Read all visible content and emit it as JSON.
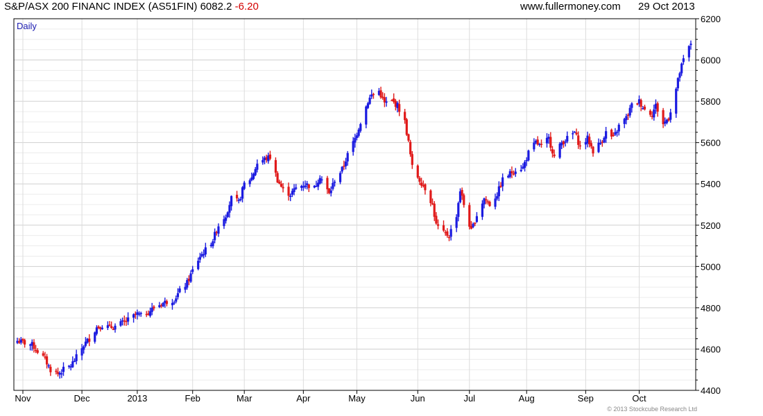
{
  "header": {
    "title": "S&P/ASX 200 FINANC INDEX (AS51FIN) 6082.2",
    "change": "-6.20",
    "site": "www.fullermoney.com",
    "date": "29 Oct 2013"
  },
  "footer": {
    "copyright": "© 2013 Stockcube Research Ltd"
  },
  "colors": {
    "up": "#1a1ae0",
    "down": "#e01a1a",
    "grid": "#d4d4d4",
    "frame": "#000000",
    "change": "#d40000",
    "period_label": "#1a1ab0"
  },
  "chart_data": {
    "type": "ohlc",
    "period_label": "Daily",
    "ylim": [
      4400,
      6200
    ],
    "y_ticks": [
      4400,
      4600,
      4800,
      5000,
      5200,
      5400,
      5600,
      5800,
      6000,
      6200
    ],
    "x_labels": [
      "Nov",
      "Dec",
      "2013",
      "Feb",
      "Mar",
      "Apr",
      "May",
      "Jun",
      "Jul",
      "Aug",
      "Sep",
      "Oct"
    ],
    "x_label_dates": [
      "2012-11-01",
      "2012-12-03",
      "2013-01-02",
      "2013-02-01",
      "2013-03-01",
      "2013-04-02",
      "2013-05-01",
      "2013-06-03",
      "2013-07-01",
      "2013-08-01",
      "2013-09-02",
      "2013-10-01"
    ],
    "x_range": [
      "2012-10-29",
      "2013-10-29"
    ],
    "grid": true,
    "close_points": [
      [
        "2012-10-29",
        4640
      ],
      [
        "2012-11-02",
        4630
      ],
      [
        "2012-11-06",
        4620
      ],
      [
        "2012-11-09",
        4590
      ],
      [
        "2012-11-13",
        4550
      ],
      [
        "2012-11-16",
        4500
      ],
      [
        "2012-11-20",
        4480
      ],
      [
        "2012-11-23",
        4500
      ],
      [
        "2012-11-27",
        4520
      ],
      [
        "2012-11-30",
        4560
      ],
      [
        "2012-12-04",
        4620
      ],
      [
        "2012-12-07",
        4650
      ],
      [
        "2012-12-11",
        4705
      ],
      [
        "2012-12-14",
        4715
      ],
      [
        "2012-12-18",
        4705
      ],
      [
        "2012-12-21",
        4710
      ],
      [
        "2012-12-27",
        4735
      ],
      [
        "2013-01-02",
        4770
      ],
      [
        "2013-01-04",
        4760
      ],
      [
        "2013-01-08",
        4780
      ],
      [
        "2013-01-11",
        4800
      ],
      [
        "2013-01-15",
        4820
      ],
      [
        "2013-01-18",
        4830
      ],
      [
        "2013-01-22",
        4840
      ],
      [
        "2013-01-25",
        4880
      ],
      [
        "2013-01-29",
        4920
      ],
      [
        "2013-02-01",
        4980
      ],
      [
        "2013-02-05",
        5050
      ],
      [
        "2013-02-08",
        5080
      ],
      [
        "2013-02-12",
        5130
      ],
      [
        "2013-02-15",
        5200
      ],
      [
        "2013-02-19",
        5250
      ],
      [
        "2013-02-22",
        5330
      ],
      [
        "2013-02-26",
        5310
      ],
      [
        "2013-03-01",
        5400
      ],
      [
        "2013-03-05",
        5430
      ],
      [
        "2013-03-08",
        5500
      ],
      [
        "2013-03-12",
        5520
      ],
      [
        "2013-03-15",
        5530
      ],
      [
        "2013-03-19",
        5420
      ],
      [
        "2013-03-22",
        5370
      ],
      [
        "2013-03-26",
        5350
      ],
      [
        "2013-03-29",
        5380
      ],
      [
        "2013-04-03",
        5400
      ],
      [
        "2013-04-08",
        5380
      ],
      [
        "2013-04-11",
        5440
      ],
      [
        "2013-04-16",
        5350
      ],
      [
        "2013-04-19",
        5420
      ],
      [
        "2013-04-23",
        5470
      ],
      [
        "2013-04-26",
        5540
      ],
      [
        "2013-04-30",
        5620
      ],
      [
        "2013-05-03",
        5700
      ],
      [
        "2013-05-07",
        5800
      ],
      [
        "2013-05-09",
        5830
      ],
      [
        "2013-05-13",
        5850
      ],
      [
        "2013-05-16",
        5790
      ],
      [
        "2013-05-20",
        5800
      ],
      [
        "2013-05-23",
        5780
      ],
      [
        "2013-05-27",
        5700
      ],
      [
        "2013-05-29",
        5600
      ],
      [
        "2013-05-31",
        5480
      ],
      [
        "2013-06-04",
        5420
      ],
      [
        "2013-06-07",
        5380
      ],
      [
        "2013-06-11",
        5300
      ],
      [
        "2013-06-13",
        5200
      ],
      [
        "2013-06-17",
        5160
      ],
      [
        "2013-06-20",
        5150
      ],
      [
        "2013-06-24",
        5250
      ],
      [
        "2013-06-26",
        5370
      ],
      [
        "2013-06-28",
        5300
      ],
      [
        "2013-07-02",
        5170
      ],
      [
        "2013-07-05",
        5250
      ],
      [
        "2013-07-09",
        5330
      ],
      [
        "2013-07-12",
        5300
      ],
      [
        "2013-07-16",
        5350
      ],
      [
        "2013-07-19",
        5420
      ],
      [
        "2013-07-23",
        5450
      ],
      [
        "2013-07-26",
        5470
      ],
      [
        "2013-07-30",
        5480
      ],
      [
        "2013-08-02",
        5550
      ],
      [
        "2013-08-06",
        5600
      ],
      [
        "2013-08-09",
        5580
      ],
      [
        "2013-08-13",
        5620
      ],
      [
        "2013-08-16",
        5530
      ],
      [
        "2013-08-20",
        5600
      ],
      [
        "2013-08-23",
        5620
      ],
      [
        "2013-08-27",
        5650
      ],
      [
        "2013-08-30",
        5580
      ],
      [
        "2013-09-03",
        5620
      ],
      [
        "2013-09-06",
        5560
      ],
      [
        "2013-09-10",
        5600
      ],
      [
        "2013-09-13",
        5650
      ],
      [
        "2013-09-17",
        5620
      ],
      [
        "2013-09-20",
        5680
      ],
      [
        "2013-09-24",
        5720
      ],
      [
        "2013-09-27",
        5780
      ],
      [
        "2013-10-01",
        5800
      ],
      [
        "2013-10-04",
        5760
      ],
      [
        "2013-10-08",
        5740
      ],
      [
        "2013-10-10",
        5780
      ],
      [
        "2013-10-14",
        5690
      ],
      [
        "2013-10-17",
        5720
      ],
      [
        "2013-10-21",
        5860
      ],
      [
        "2013-10-23",
        5940
      ],
      [
        "2013-10-25",
        6000
      ],
      [
        "2013-10-29",
        6082
      ]
    ]
  }
}
